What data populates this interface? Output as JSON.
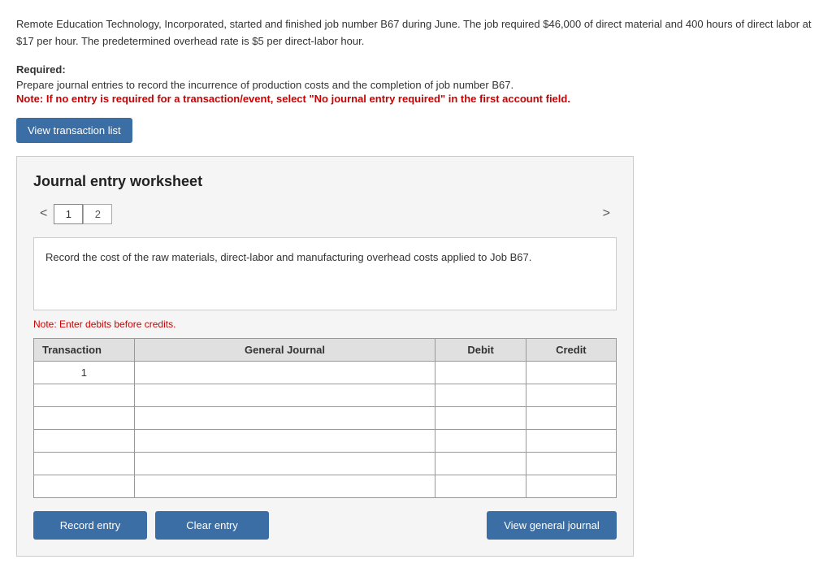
{
  "intro": {
    "text": "Remote Education Technology, Incorporated, started and finished job number B67 during June. The job required $46,000 of direct material and 400 hours of direct labor at $17 per hour. The predetermined overhead rate is $5 per direct-labor hour."
  },
  "required": {
    "title": "Required:",
    "body": "Prepare journal entries to record the incurrence of production costs and the completion of job number B67.",
    "note": "Note: If no entry is required for a transaction/event, select \"No journal entry required\" in the first account field."
  },
  "buttons": {
    "view_transaction": "View transaction list",
    "record_entry": "Record entry",
    "clear_entry": "Clear entry",
    "view_general_journal": "View general journal"
  },
  "worksheet": {
    "title": "Journal entry worksheet",
    "pages": [
      {
        "number": "1",
        "active": true
      },
      {
        "number": "2",
        "active": false
      }
    ],
    "description": "Record the cost of the raw materials, direct-labor and manufacturing overhead costs applied to Job B67.",
    "note": "Note: Enter debits before credits.",
    "table": {
      "headers": {
        "transaction": "Transaction",
        "general_journal": "General Journal",
        "debit": "Debit",
        "credit": "Credit"
      },
      "rows": [
        {
          "transaction": "1",
          "general_journal": "",
          "debit": "",
          "credit": ""
        },
        {
          "transaction": "",
          "general_journal": "",
          "debit": "",
          "credit": ""
        },
        {
          "transaction": "",
          "general_journal": "",
          "debit": "",
          "credit": ""
        },
        {
          "transaction": "",
          "general_journal": "",
          "debit": "",
          "credit": ""
        },
        {
          "transaction": "",
          "general_journal": "",
          "debit": "",
          "credit": ""
        },
        {
          "transaction": "",
          "general_journal": "",
          "debit": "",
          "credit": ""
        }
      ]
    }
  }
}
